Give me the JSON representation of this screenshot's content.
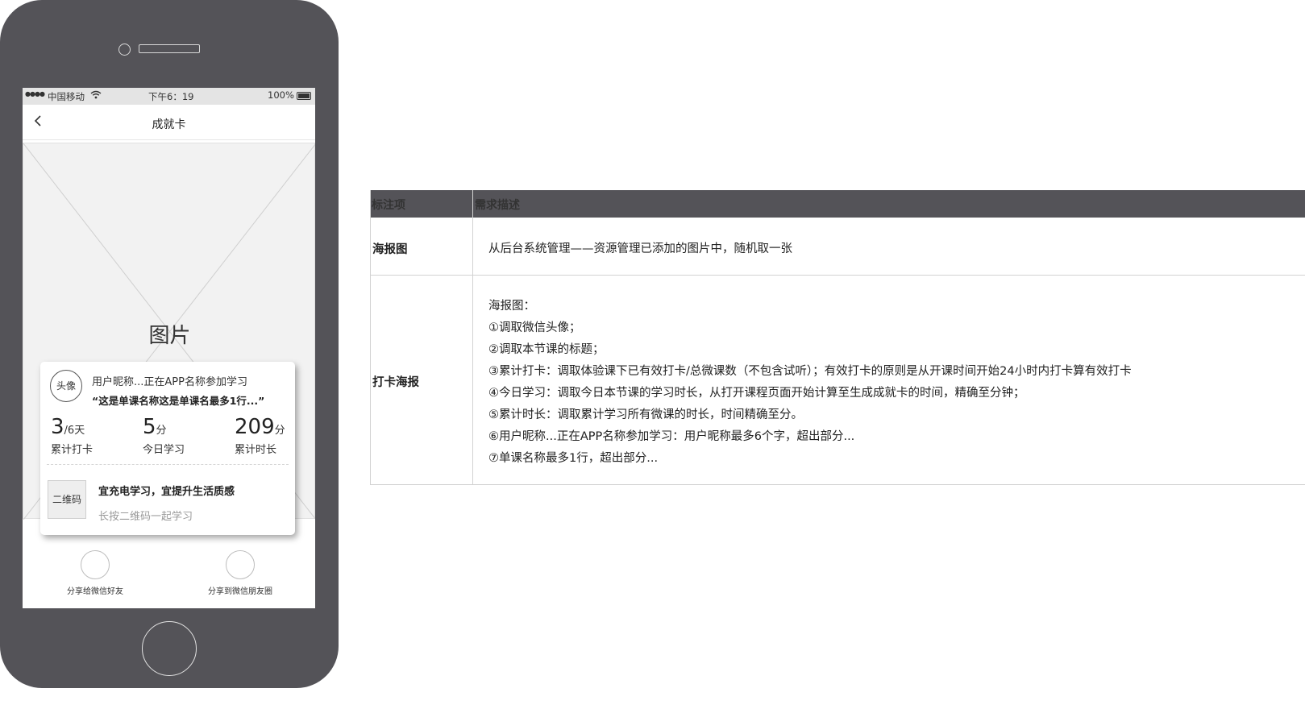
{
  "status_bar": {
    "signal": "●●●●",
    "carrier": "中国移动",
    "time": "下午6：19",
    "battery": "100%"
  },
  "nav": {
    "title": "成就卡"
  },
  "poster": {
    "image_label": "图片"
  },
  "card": {
    "avatar_label": "头像",
    "user_line": "用户昵称...正在APP名称参加学习",
    "course_title": "“这是单课名称这是单课名最多1行...”",
    "stats": [
      {
        "value": "3",
        "unit": "/6天",
        "label": "累计打卡"
      },
      {
        "value": "5",
        "unit": "分",
        "label": "今日学习"
      },
      {
        "value": "209",
        "unit": "分",
        "label": "累计时长"
      }
    ],
    "qr_label": "二维码",
    "slogan": "宜充电学习，宜提升生活质感",
    "qr_hint": "长按二维码一起学习"
  },
  "share": {
    "friend_label": "分享给微信好友",
    "moments_label": "分享到微信朋友圈"
  },
  "annotation_table": {
    "headers": [
      "标注项",
      "需求描述"
    ],
    "rows": [
      {
        "name": "海报图",
        "lines": [
          "从后台系统管理——资源管理已添加的图片中，随机取一张"
        ]
      },
      {
        "name": "打卡海报",
        "lines": [
          "海报图：",
          "①调取微信头像；",
          "②调取本节课的标题；",
          "③累计打卡：调取体验课下已有效打卡/总微课数（不包含试听）；有效打卡的原则是从开课时间开始24小时内打卡算有效打卡",
          "④今日学习：调取今日本节课的学习时长，从打开课程页面开始计算至生成成就卡的时间，精确至分钟；",
          "⑤累计时长：调取累计学习所有微课的时长，时间精确至分。",
          "⑥用户昵称...正在APP名称参加学习：用户昵称最多6个字，超出部分...",
          "⑦单课名称最多1行，超出部分..."
        ]
      }
    ]
  },
  "colors": {
    "phone_body": "#545358",
    "table_header": "#545358",
    "status_bar": "#e4e4e4",
    "placeholder": "#f2f2f2"
  }
}
